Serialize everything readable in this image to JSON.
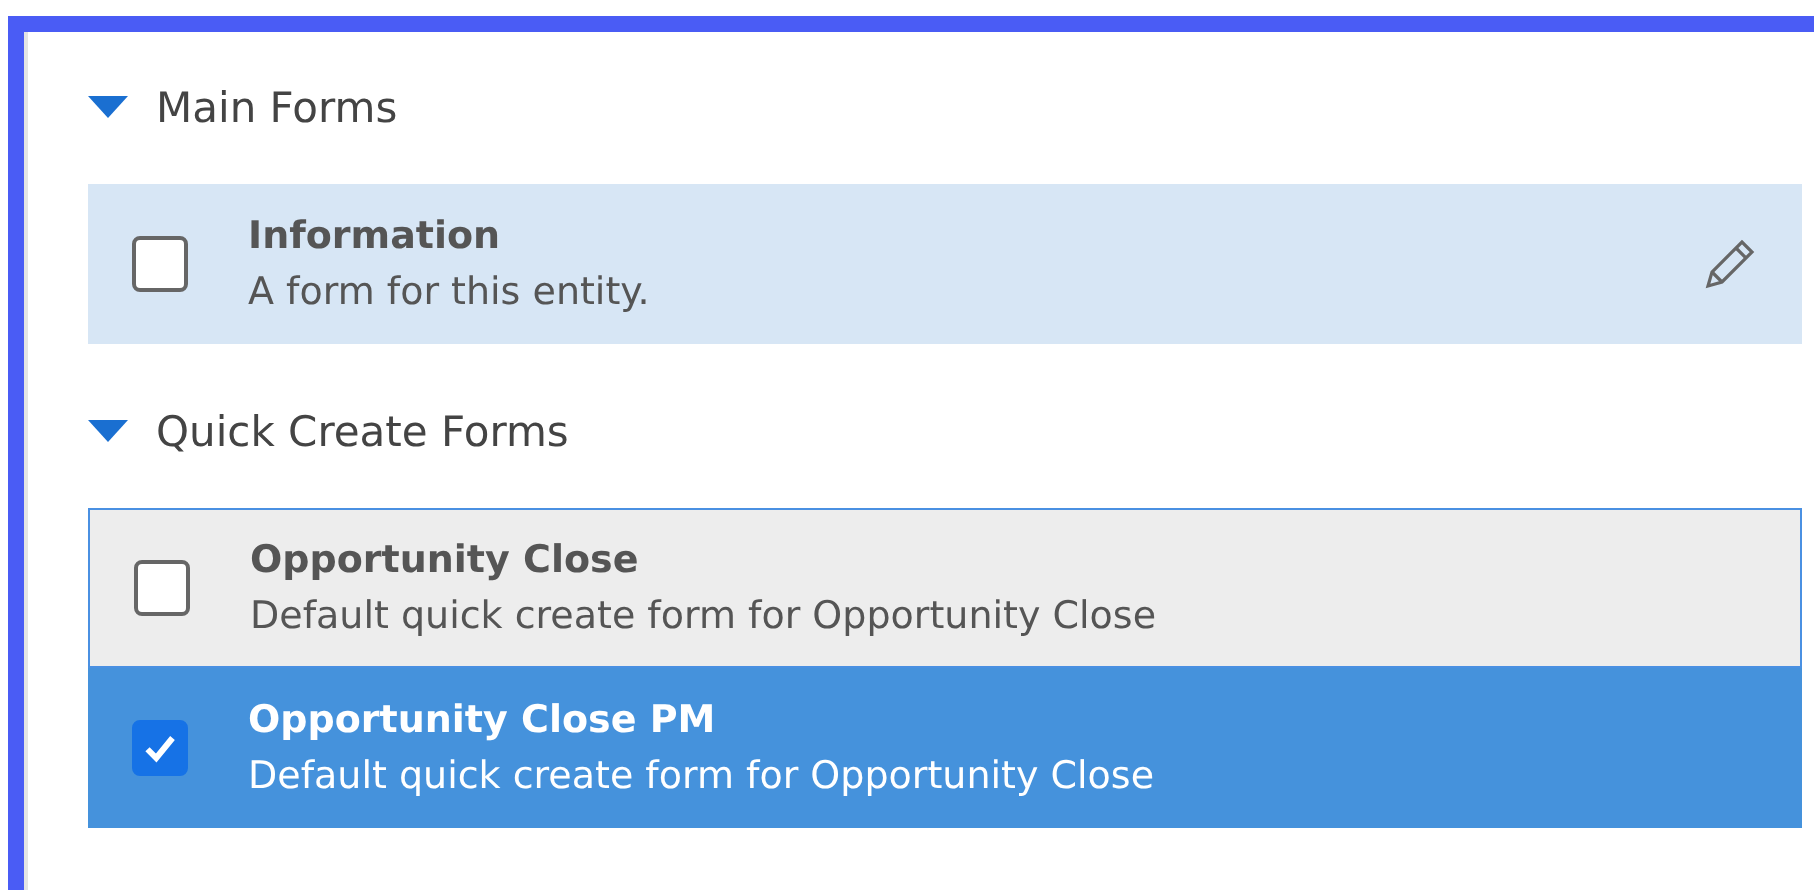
{
  "sections": [
    {
      "title": "Main Forms",
      "expanded": true,
      "rows": [
        {
          "name": "Information",
          "description": "A form for this entity.",
          "checked": false,
          "selected": false,
          "hovered": true,
          "focused": false,
          "edit_icon": true
        }
      ]
    },
    {
      "title": "Quick Create Forms",
      "expanded": true,
      "rows": [
        {
          "name": "Opportunity Close",
          "description": "Default quick create form for Opportunity Close",
          "checked": false,
          "selected": false,
          "hovered": false,
          "focused": true,
          "edit_icon": false
        },
        {
          "name": "Opportunity Close PM",
          "description": "Default quick create form for Opportunity Close",
          "checked": true,
          "selected": true,
          "hovered": false,
          "focused": false,
          "edit_icon": false
        }
      ]
    }
  ]
}
